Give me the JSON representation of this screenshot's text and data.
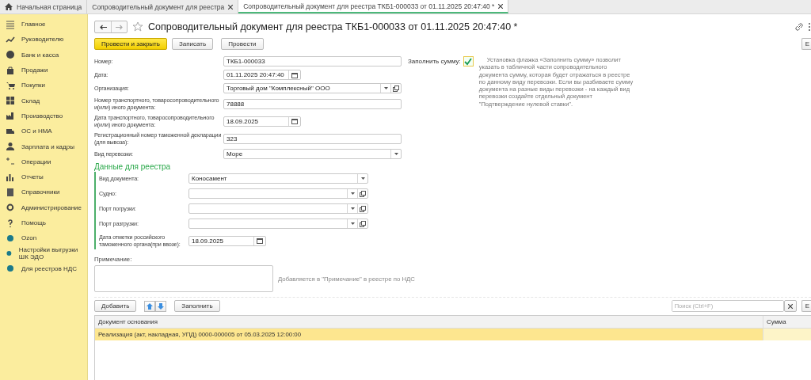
{
  "tabs": [
    {
      "label": "Начальная страница",
      "selected": false,
      "closable": false
    },
    {
      "label": "Сопроводительный документ для реестра",
      "selected": false,
      "closable": true
    },
    {
      "label": "Сопроводительный документ для реестра ТКБ1-000033 от 01.11.2025 20:47:40 *",
      "selected": true,
      "closable": true
    }
  ],
  "sidebar": {
    "items": [
      {
        "label": "Главное"
      },
      {
        "label": "Руководителю"
      },
      {
        "label": "Банк и касса"
      },
      {
        "label": "Продажи"
      },
      {
        "label": "Покупки"
      },
      {
        "label": "Склад"
      },
      {
        "label": "Производство"
      },
      {
        "label": "ОС и НМА"
      },
      {
        "label": "Зарплата и кадры"
      },
      {
        "label": "Операции"
      },
      {
        "label": "Отчеты"
      },
      {
        "label": "Справочники"
      },
      {
        "label": "Администрирование"
      },
      {
        "label": "Помощь"
      },
      {
        "label": "Ozon"
      },
      {
        "label": "Настройки выгрузки ШК ЭДО"
      },
      {
        "label": "Для реестров НДС"
      }
    ]
  },
  "header": {
    "title": "Сопроводительный документ для реестра ТКБ1-000033 от 01.11.2025 20:47:40 *",
    "favorite": false,
    "more_button": "Е"
  },
  "toolbar": [
    {
      "label": "Провести и закрыть",
      "primary": true
    },
    {
      "label": "Записать",
      "primary": false
    },
    {
      "label": "Провести",
      "primary": false
    }
  ],
  "fields": [
    {
      "label": "Номер:",
      "value": "ТКБ1-000033",
      "kind": "text"
    },
    {
      "label": "Дата:",
      "value": "01.11.2025 20:47:40",
      "kind": "date"
    },
    {
      "label": "Организация:",
      "value": "Торговый дом \"Комплексный\" ООО",
      "kind": "select",
      "open_button": true
    },
    {
      "label": "Номер транспортного, товаросопроводительного и(или) иного документа:",
      "value": "78888",
      "kind": "text"
    },
    {
      "label": "Дата транспортного, товаросопроводительного и(или) иного документа:",
      "value": "18.09.2025",
      "kind": "date"
    },
    {
      "label": "Регистрационный номер таможенной декларации (для вывоза):",
      "value": "323",
      "kind": "text"
    },
    {
      "label": "Вид перевозки:",
      "value": "Море",
      "kind": "select",
      "open_button": false
    }
  ],
  "fill_sum": {
    "label": "Заполнить сумму:",
    "checked": true,
    "hint": "Установка флажка «Заполнить сумму» позволит указать в табличной части сопроводительного документа сумму, которая будет отражаться в реестре по данному виду перевозки. Если вы разбиваете сумму документа на разные виды перевозки - на каждый вид перевозки создайте отдельный документ \"Подтверждение нулевой ставки\"."
  },
  "registry": {
    "title": "Данные для реестра",
    "fields": [
      {
        "label": "Вид документа:",
        "value": "Коносамент",
        "kind": "select",
        "open_button": false
      },
      {
        "label": "Судно:",
        "kind": "select",
        "open_button": true
      },
      {
        "label": "Порт погрузки:",
        "kind": "select",
        "open_button": true
      },
      {
        "label": "Порт разгрузки:",
        "kind": "select",
        "open_button": true
      },
      {
        "label": "Дата отметки российского таможенного органа(при ввозе):",
        "value": "18.09.2025",
        "kind": "date"
      }
    ]
  },
  "note": {
    "label": "Примечание:",
    "hint": "Добавляется в \"Примечание\" в реестре по НДС"
  },
  "table_toolbar": {
    "add": "Добавить",
    "fill": "Заполнить",
    "search_placeholder": "Поиск (Ctrl+F)",
    "more_button": "Е"
  },
  "table": {
    "columns": [
      "Документ основания",
      "Сумма"
    ],
    "rows": [
      {
        "cells": [
          "Реализация (акт, накладная, УПД) 0000-000005 от 05.03.2025 12:00:00",
          ""
        ],
        "selected": true
      }
    ]
  }
}
